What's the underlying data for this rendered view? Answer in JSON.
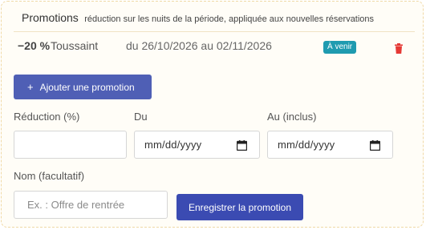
{
  "header": {
    "title": "Promotions",
    "subtitle": "réduction sur les nuits de la période, appliquée aux nouvelles réservations"
  },
  "promotion": {
    "percent": "−20 %",
    "name": "Toussaint",
    "dates": "du 26/10/2026 au 02/11/2026",
    "status": "À venir"
  },
  "add_button": {
    "label": "Ajouter une promotion"
  },
  "form": {
    "reduction_label": "Réduction (%)",
    "from_label": "Du",
    "to_label": "Au (inclus)",
    "name_label": "Nom (facultatif)",
    "date_placeholder": "mm/dd/yyyy",
    "name_placeholder": "Ex. : Offre de rentrée",
    "save_label": "Enregistrer la promotion"
  },
  "colors": {
    "primary": "#4f5fb5",
    "primary_dark": "#3b4bb2",
    "badge": "#1f9bb0",
    "delete": "#e53935"
  },
  "icons": {
    "add": "plus-icon",
    "delete": "trash-icon",
    "date": "calendar-icon"
  }
}
